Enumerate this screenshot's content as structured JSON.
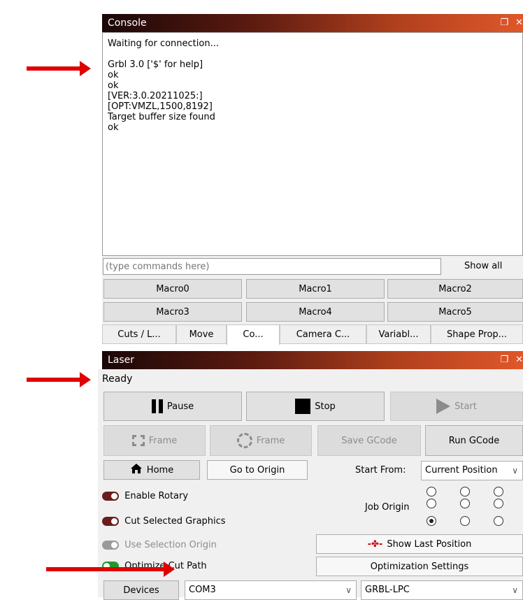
{
  "console": {
    "title": "Console",
    "lines": [
      "Waiting for connection...",
      "",
      "Grbl 3.0 ['$' for help]",
      "ok",
      "ok",
      "[VER:3.0.20211025:]",
      "[OPT:VMZL,1500,8192]",
      "Target buffer size found",
      "ok"
    ],
    "input_placeholder": "(type commands here)",
    "show_all_label": "Show all",
    "macros": [
      "Macro0",
      "Macro1",
      "Macro2",
      "Macro3",
      "Macro4",
      "Macro5"
    ],
    "tabs": [
      "Cuts / L...",
      "Move",
      "Co...",
      "Camera C...",
      "Variabl...",
      "Shape Prop..."
    ],
    "active_tab": "Co..."
  },
  "laser": {
    "title": "Laser",
    "status": "Ready",
    "pause_label": "Pause",
    "stop_label": "Stop",
    "start_label": "Start",
    "frame_label": "Frame",
    "frame2_label": "Frame",
    "save_gcode_label": "Save GCode",
    "run_gcode_label": "Run GCode",
    "home_label": "Home",
    "go_to_origin_label": "Go to Origin",
    "start_from_label": "Start From:",
    "start_from_value": "Current Position",
    "enable_rotary_label": "Enable Rotary",
    "cut_selected_label": "Cut Selected Graphics",
    "use_selection_origin_label": "Use Selection Origin",
    "optimize_cut_path_label": "Optimize Cut Path",
    "job_origin_label": "Job Origin",
    "job_origin_selected": "bottom-left",
    "show_last_position_label": "Show Last Position",
    "optimization_settings_label": "Optimization Settings",
    "devices_label": "Devices",
    "port_value": "COM3",
    "device_value": "GRBL-LPC"
  },
  "colors": {
    "arrow": "#e00000",
    "titlebar_dark": "#1a0707",
    "titlebar_light": "#e0572a",
    "toggle_on": "#6b1d1d",
    "toggle_green": "#1f9a2a"
  }
}
